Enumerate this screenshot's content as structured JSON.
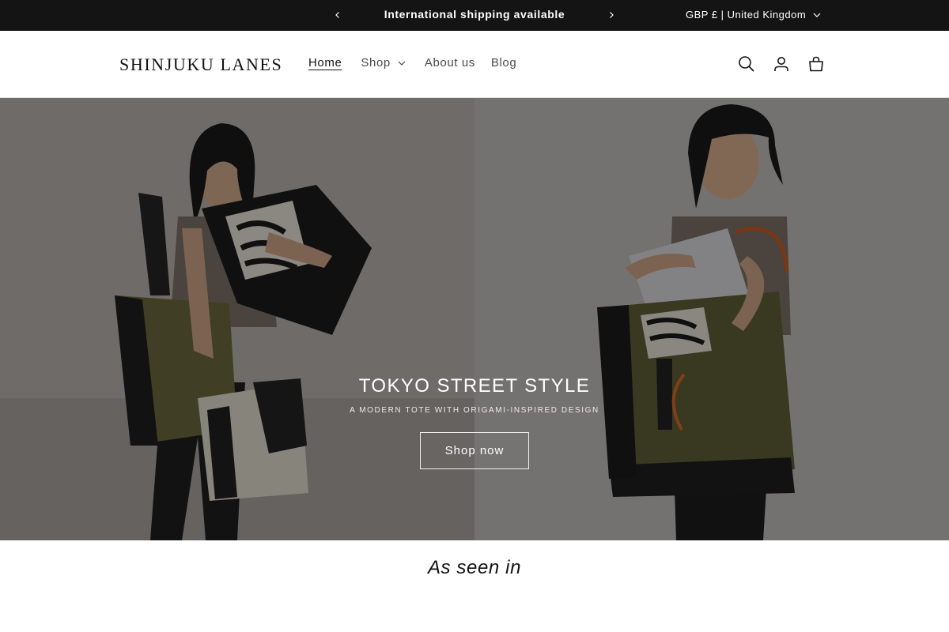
{
  "announcement": {
    "text": "International shipping available",
    "prev_icon": "chevron-left-icon",
    "next_icon": "chevron-right-icon",
    "background": "#141414"
  },
  "locale": {
    "label": "GBP £ | United Kingdom",
    "icon": "chevron-down-icon"
  },
  "header": {
    "logo": "SHINJUKU LANES",
    "nav": {
      "home": "Home",
      "shop": "Shop",
      "about": "About us",
      "blog": "Blog"
    },
    "icons": [
      "search-icon",
      "account-icon",
      "cart-icon"
    ]
  },
  "hero": {
    "title": "TOKYO STREET STYLE",
    "subtitle": "A MODERN TOTE WITH ORIGAMI-INSPIRED DESIGN",
    "button": "Shop now",
    "overlay_opacity": 0.4
  },
  "featured": {
    "title": "As seen in"
  }
}
